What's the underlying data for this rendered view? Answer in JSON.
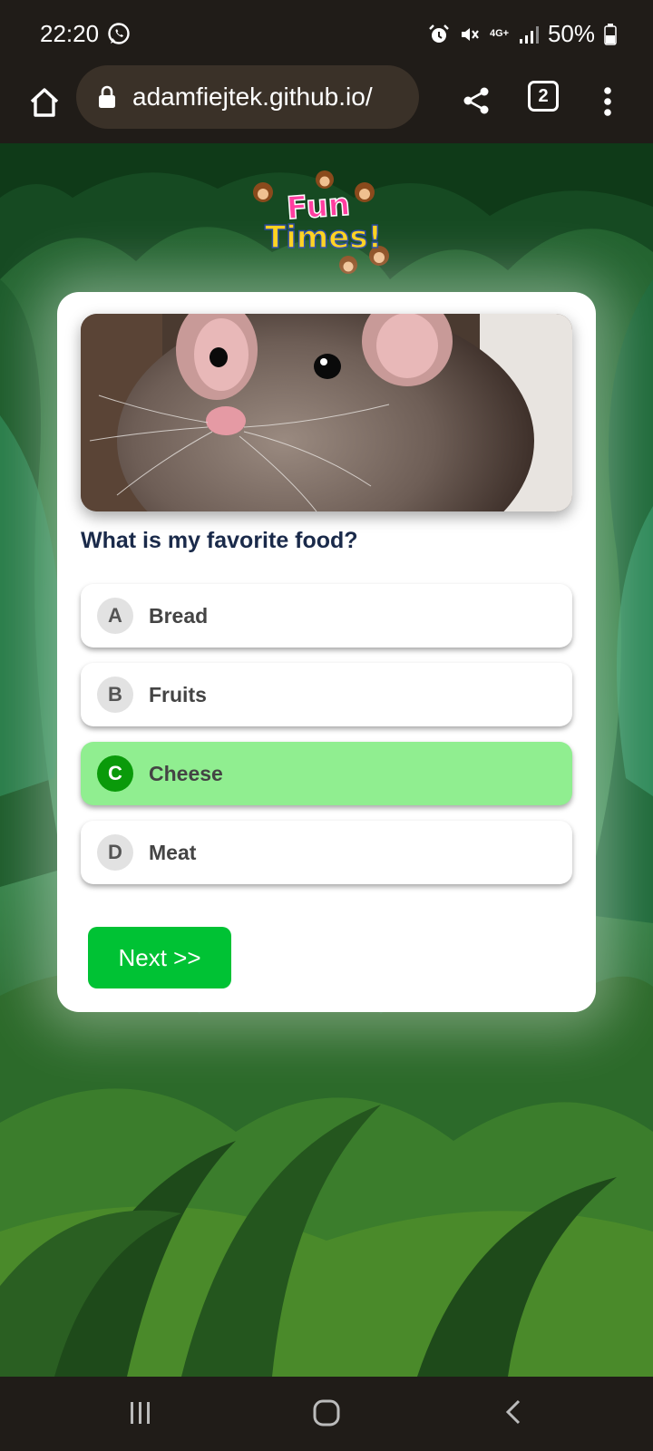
{
  "status_bar": {
    "time": "22:20",
    "battery": "50%",
    "network": "4G+",
    "icons": [
      "whatsapp-icon",
      "alarm-icon",
      "mute-icon",
      "signal-icon",
      "battery-icon"
    ]
  },
  "browser": {
    "url": "adamfiejtek.github.io/",
    "tab_count": "2",
    "icons": [
      "home-icon",
      "lock-icon",
      "share-icon",
      "menu-icon"
    ]
  },
  "logo": {
    "line1": "Fun",
    "line2": "Times!"
  },
  "quiz": {
    "question": "What is my favorite food?",
    "answers": [
      {
        "letter": "A",
        "text": "Bread",
        "state": "default"
      },
      {
        "letter": "B",
        "text": "Fruits",
        "state": "default"
      },
      {
        "letter": "C",
        "text": "Cheese",
        "state": "correct"
      },
      {
        "letter": "D",
        "text": "Meat",
        "state": "default"
      }
    ],
    "next_label": "Next >>"
  },
  "colors": {
    "correct_bg": "#90ee90",
    "correct_badge": "#0a9a0a",
    "next_button": "#00c234",
    "question_text": "#1a2a4a"
  },
  "nav_bar": {
    "icons": [
      "recents-icon",
      "home-icon",
      "back-icon"
    ]
  }
}
